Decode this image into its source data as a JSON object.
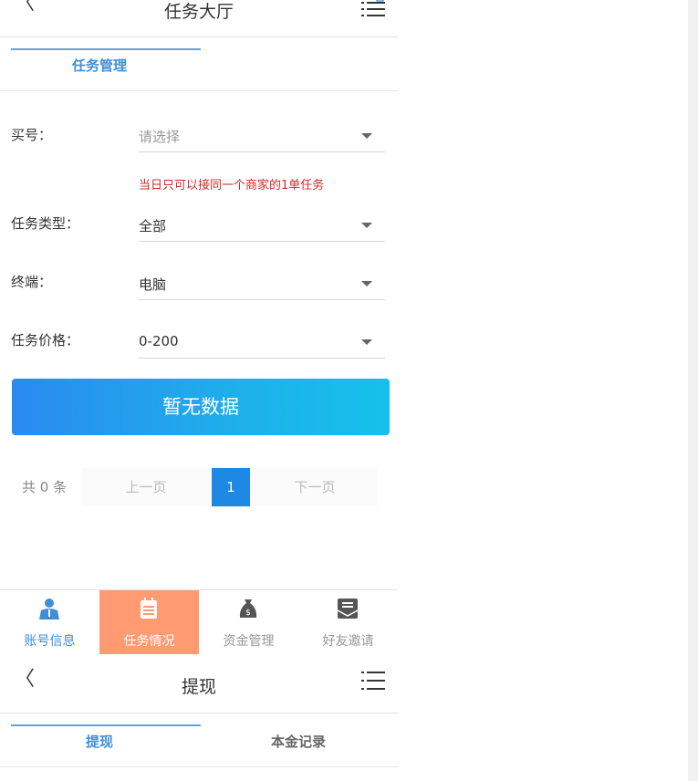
{
  "screen1": {
    "header": {
      "back_glyph": "〈",
      "title": "任务大厅"
    },
    "tabs": [
      {
        "label": "任务管理"
      }
    ],
    "form": {
      "buyer": {
        "label": "买号：",
        "placeholder": "请选择"
      },
      "notice": "当日只可以接同一个商家的1单任务",
      "task_type": {
        "label": "任务类型：",
        "value": "全部"
      },
      "terminal": {
        "label": "终端：",
        "value": "电脑"
      },
      "price": {
        "label": "任务价格：",
        "value": "0-200"
      }
    },
    "no_data_label": "暂无数据",
    "pager": {
      "total": "共 0 条",
      "prev": "上一页",
      "current": "1",
      "next": "下一页"
    }
  },
  "tabbar": [
    {
      "label": "账号信息",
      "icon": "user-icon"
    },
    {
      "label": "任务情况",
      "icon": "clipboard-icon"
    },
    {
      "label": "资金管理",
      "icon": "money-bag-icon"
    },
    {
      "label": "好友邀请",
      "icon": "mail-icon"
    }
  ],
  "screen2": {
    "header": {
      "back_glyph": "〈",
      "title": "提现"
    },
    "tabs": [
      {
        "label": "提现"
      },
      {
        "label": "本金记录"
      }
    ]
  },
  "colors": {
    "accent": "#1e88e5",
    "tab_active": "#3e8fd8",
    "tabbar_active_bg": "#ff9a73",
    "notice": "#d32a2a"
  }
}
